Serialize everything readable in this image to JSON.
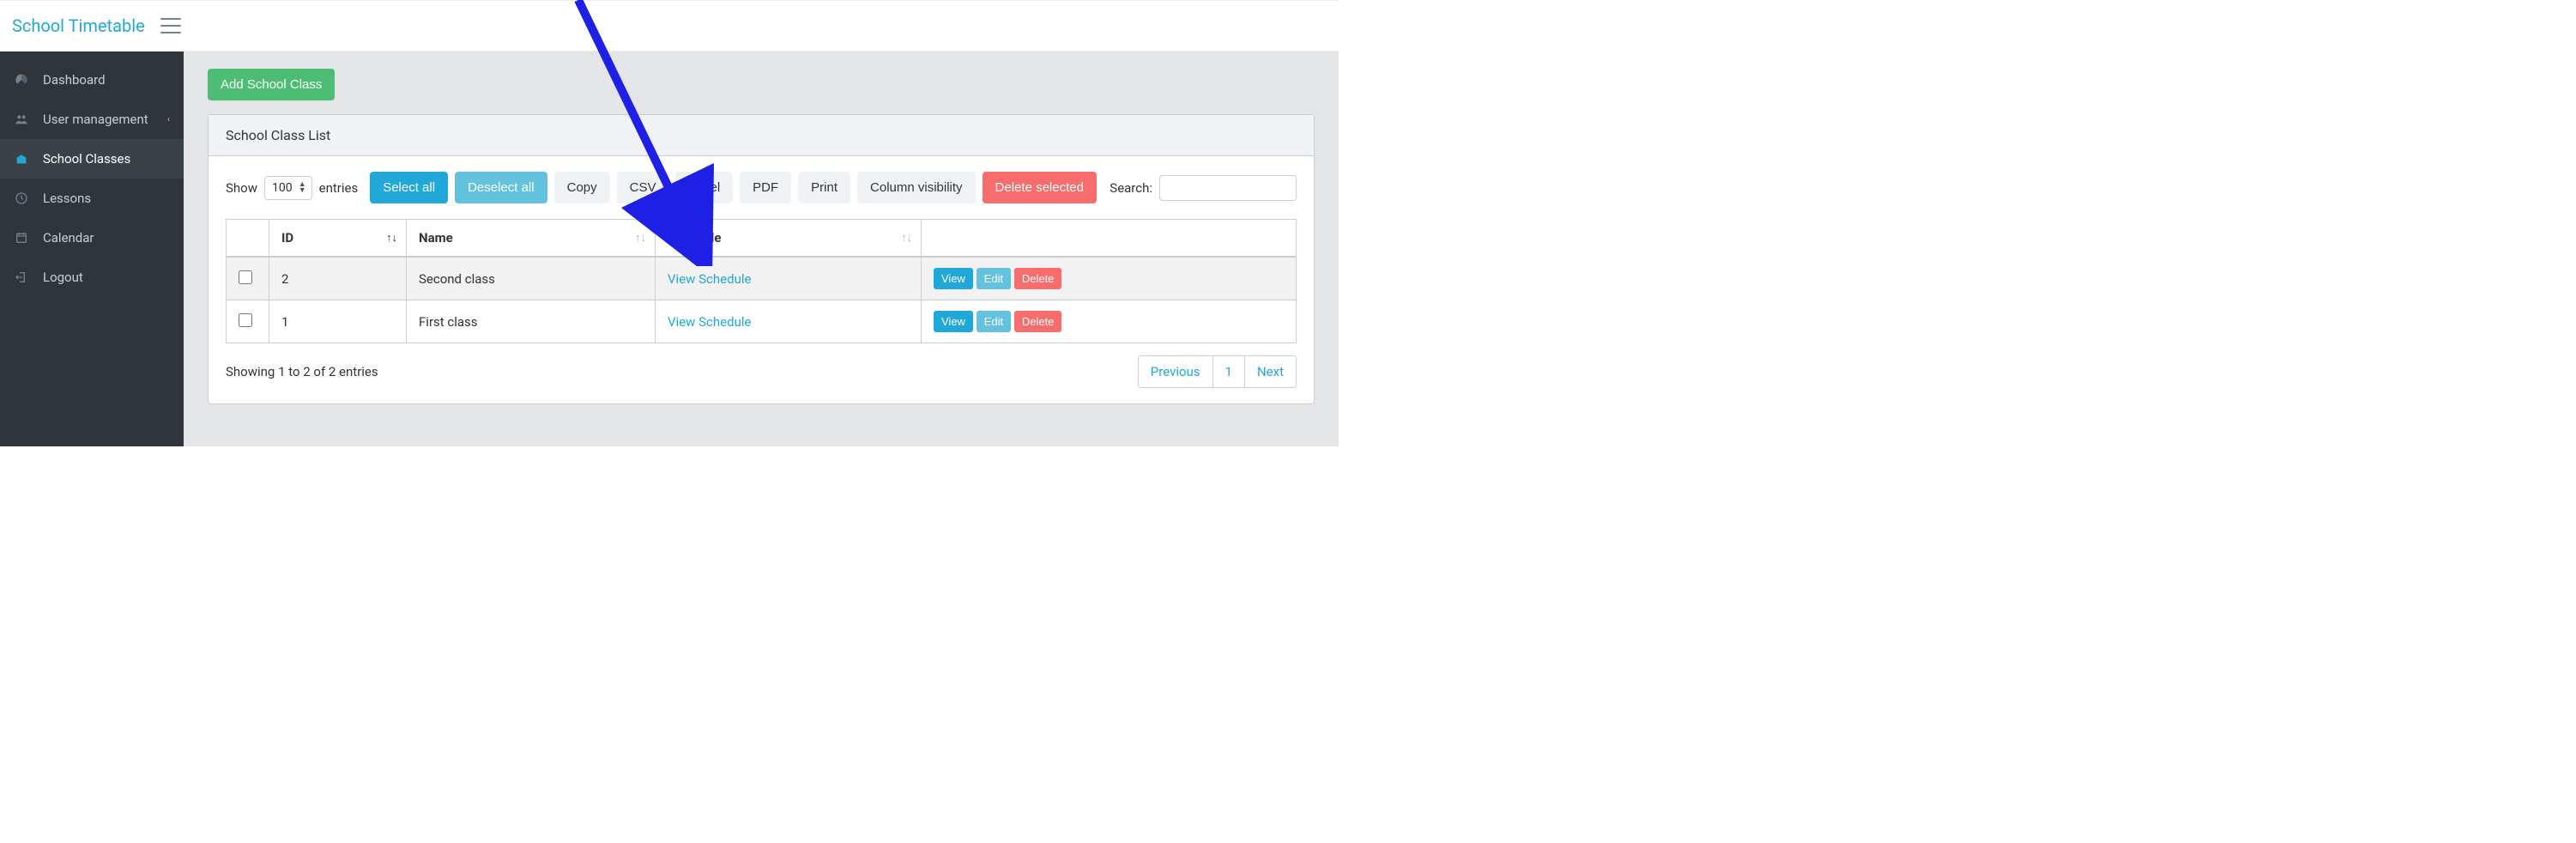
{
  "brand": "School Timetable",
  "sidebar": {
    "items": [
      {
        "label": "Dashboard"
      },
      {
        "label": "User management"
      },
      {
        "label": "School Classes"
      },
      {
        "label": "Lessons"
      },
      {
        "label": "Calendar"
      },
      {
        "label": "Logout"
      }
    ]
  },
  "main": {
    "add_btn": "Add School Class",
    "card_title": "School Class List",
    "show_label": "Show",
    "entries_label": "entries",
    "entries_value": "100",
    "buttons": {
      "select_all": "Select all",
      "deselect_all": "Deselect all",
      "copy": "Copy",
      "csv": "CSV",
      "excel": "Excel",
      "pdf": "PDF",
      "print": "Print",
      "col_vis": "Column visibility",
      "delete_sel": "Delete selected"
    },
    "search_label": "Search:",
    "columns": {
      "id": "ID",
      "name": "Name",
      "schedule": "Schedule"
    },
    "rows": [
      {
        "id": "2",
        "name": "Second class",
        "schedule": "View Schedule"
      },
      {
        "id": "1",
        "name": "First class",
        "schedule": "View Schedule"
      }
    ],
    "actions": {
      "view": "View",
      "edit": "Edit",
      "delete": "Delete"
    },
    "footer_info": "Showing 1 to 2 of 2 entries",
    "pagination": {
      "prev": "Previous",
      "page1": "1",
      "next": "Next"
    }
  }
}
